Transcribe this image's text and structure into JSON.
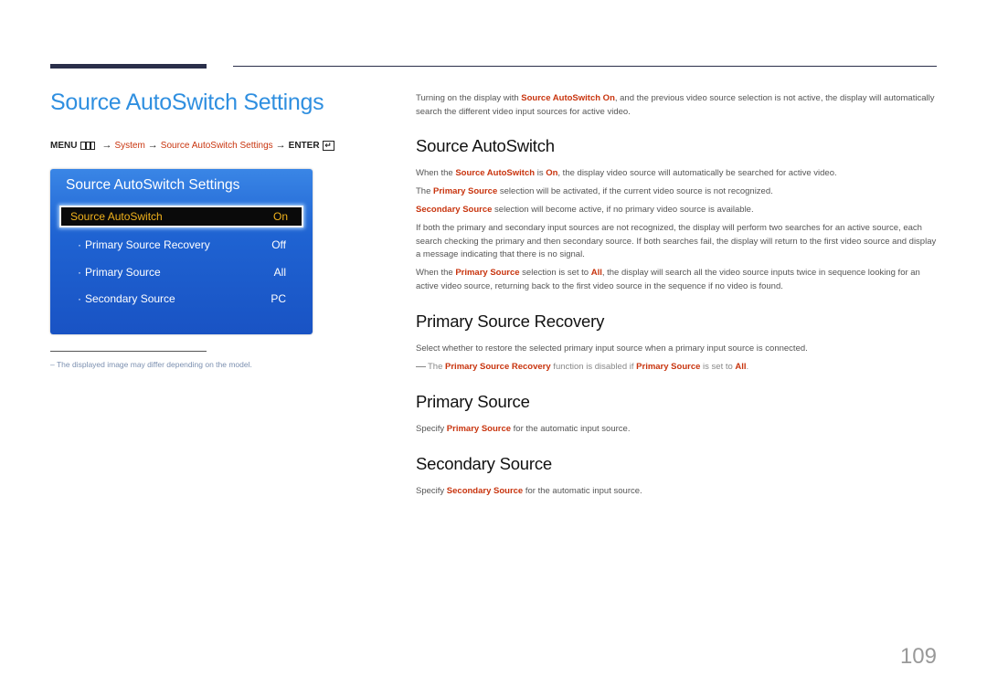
{
  "page": {
    "title": "Source AutoSwitch Settings",
    "page_number": "109"
  },
  "menu_path": {
    "menu": "MENU",
    "step1": "System",
    "step2": "Source AutoSwitch Settings",
    "enter": "ENTER",
    "arrow": "→"
  },
  "osd": {
    "title": "Source AutoSwitch Settings",
    "items": [
      {
        "label": "Source AutoSwitch",
        "value": "On",
        "selected": true
      },
      {
        "label": "Primary Source Recovery",
        "value": "Off"
      },
      {
        "label": "Primary Source",
        "value": "All"
      },
      {
        "label": "Secondary Source",
        "value": "PC"
      }
    ],
    "bullet": "·"
  },
  "footnote": {
    "dash": "–",
    "text": "The displayed image may differ depending on the model."
  },
  "intro": {
    "t1": "Turning on the display with ",
    "h1": "Source AutoSwitch On",
    "t2": ", and the previous video source selection is not active, the display will automatically search the different video input sources for active video."
  },
  "sections": {
    "autoswitch": {
      "heading": "Source AutoSwitch",
      "p1": {
        "t1": "When the ",
        "h1": "Source AutoSwitch",
        "t2": " is ",
        "h2": "On",
        "t3": ", the display video source will automatically be searched for active video."
      },
      "p2": {
        "t1": "The ",
        "h1": "Primary Source",
        "t2": " selection will be activated, if the current video source is not recognized."
      },
      "p3": {
        "h1": "Secondary Source",
        "t1": " selection will become active, if no primary video source is available."
      },
      "p4": "If both the primary and secondary input sources are not recognized, the display will perform two searches for an active source, each search checking the primary and then secondary source. If both searches fail, the display will return to the first video source and display a message indicating that there is no signal.",
      "p5": {
        "t1": "When the ",
        "h1": "Primary Source",
        "t2": " selection is set to ",
        "h2": "All",
        "t3": ", the display will search all the video source inputs twice in sequence looking for an active video source, returning back to the first video source in the sequence if no video is found."
      }
    },
    "recovery": {
      "heading": "Primary Source Recovery",
      "p1": "Select whether to restore the selected primary input source when a primary input source is connected.",
      "note": {
        "t1": "The ",
        "h1": "Primary Source Recovery",
        "t2": " function is disabled if ",
        "h2": "Primary Source",
        "t3": " is set to ",
        "h3": "All",
        "t4": "."
      }
    },
    "primary": {
      "heading": "Primary Source",
      "p1": {
        "t1": "Specify ",
        "h1": "Primary Source",
        "t2": " for the automatic input source."
      }
    },
    "secondary": {
      "heading": "Secondary Source",
      "p1": {
        "t1": "Specify ",
        "h1": "Secondary Source",
        "t2": " for the automatic input source."
      }
    }
  },
  "colors": {
    "title_blue": "#2f8fe0",
    "highlight_red": "#c8340e",
    "osd_blue": "#1f63d2",
    "osd_selected_text": "#f1b21c"
  }
}
